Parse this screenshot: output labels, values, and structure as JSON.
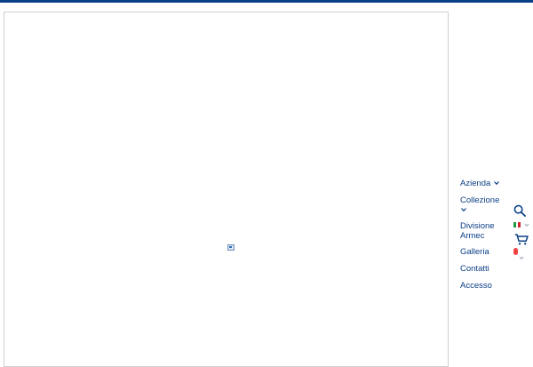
{
  "colors": {
    "brand": "#0b3f86",
    "badge": "#ef4444",
    "border": "#cfcfcf"
  },
  "menu": {
    "items": [
      {
        "label": "Azienda",
        "has_dropdown": true
      },
      {
        "label": "Collezione",
        "has_dropdown": true
      },
      {
        "label": "Divisione Armec",
        "has_dropdown": false
      },
      {
        "label": "Galleria",
        "has_dropdown": false
      },
      {
        "label": "Contatti",
        "has_dropdown": false
      },
      {
        "label": "Accesso",
        "has_dropdown": false
      }
    ]
  },
  "icons": {
    "search": "search-icon",
    "language_flag": "italy-flag-icon",
    "cart": "cart-icon",
    "broken_image": "broken-image-icon"
  }
}
